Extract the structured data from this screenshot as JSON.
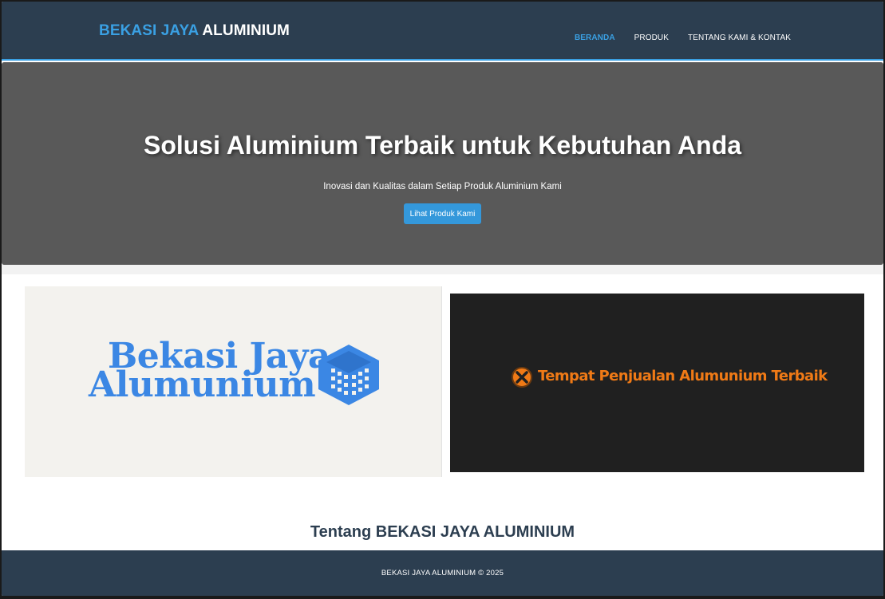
{
  "header": {
    "brand_accent": "BEKASI JAYA",
    "brand_rest": "ALUMINIUM",
    "nav": [
      "BERANDA",
      "PRODUK",
      "TENTANG KAMI & KONTAK"
    ],
    "active_nav": "BERANDA"
  },
  "hero": {
    "title": "Solusi Aluminium Terbaik untuk Kebutuhan Anda",
    "subtitle": "Inovasi dan Kualitas dalam Setiap Produk Aluminium Kami",
    "button_label": "Lihat Produk Kami"
  },
  "banners": {
    "left": {
      "line1": "Bekasi Jaya",
      "line2": "Alumunium",
      "icon": "building-icon"
    },
    "right": {
      "text": "Tempat Penjualan Alumunium Terbaik",
      "icon": "x-badge-icon"
    }
  },
  "about": {
    "title": "Tentang BEKASI JAYA ALUMINIUM"
  },
  "footer": {
    "text": "BEKASI JAYA ALUMINIUM © 2025"
  },
  "colors": {
    "header_bg": "#2c3e50",
    "accent": "#3aa0e3",
    "hero_bg": "#595959",
    "button": "#3498db",
    "logo_blue": "#3b87e4",
    "orange": "#f07a16"
  }
}
